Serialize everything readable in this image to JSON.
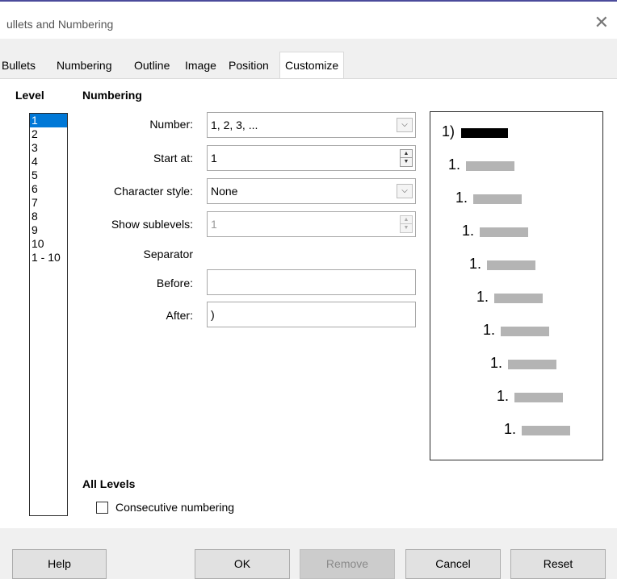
{
  "window": {
    "title": "ullets and Numbering",
    "close_glyph": "✕"
  },
  "tabs": [
    "Bullets",
    "Numbering",
    "Outline",
    "Image",
    "Position",
    "Customize"
  ],
  "active_tab": "Customize",
  "level": {
    "heading": "Level",
    "items": [
      "1",
      "2",
      "3",
      "4",
      "5",
      "6",
      "7",
      "8",
      "9",
      "10",
      "1 - 10"
    ],
    "selected": "1"
  },
  "numbering": {
    "heading": "Numbering",
    "number_label": "Number:",
    "number_value": "1, 2, 3, ...",
    "start_at_label": "Start at:",
    "start_at_value": "1",
    "char_style_label": "Character style:",
    "char_style_value": "None",
    "show_sublevels_label": "Show sublevels:",
    "show_sublevels_value": "1",
    "separator_label": "Separator",
    "before_label": "Before:",
    "before_value": "",
    "after_label": "After:",
    "after_value": ")"
  },
  "preview": {
    "first_label": "1)",
    "sub_labels": [
      "1.",
      "1.",
      "1.",
      "1.",
      "1.",
      "1.",
      "1.",
      "1.",
      "1."
    ]
  },
  "all_levels": {
    "heading": "All Levels",
    "consecutive_label": "Consecutive numbering",
    "consecutive_checked": false
  },
  "buttons": {
    "help": "Help",
    "ok": "OK",
    "remove": "Remove",
    "cancel": "Cancel",
    "reset": "Reset"
  },
  "icons": {
    "dropdown": "chevron-down-icon",
    "spin": "spin-arrows-icon",
    "close": "close-icon"
  }
}
